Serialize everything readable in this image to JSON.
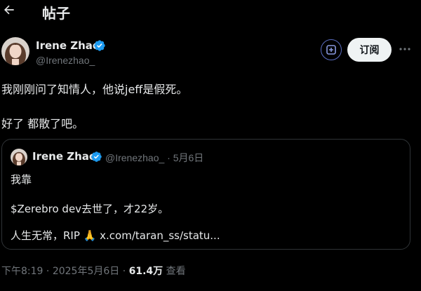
{
  "header": {
    "title": "帖子",
    "back_icon": "arrow-left-icon"
  },
  "author": {
    "name": "Irene Zhao",
    "handle": "@Irenezhao_",
    "verified": true
  },
  "actions": {
    "subscribe_label": "订阅",
    "grok_icon": "grok-icon",
    "more_icon": "more-horizontal-icon"
  },
  "post": {
    "line1": "我刚刚问了知情人，他说jeff是假死。",
    "line2": "好了 都散了吧。"
  },
  "quote": {
    "name": "Irene Zhao",
    "handle": "@Irenezhao_",
    "separator": "·",
    "date": "5月6日",
    "line1": "我靠",
    "line2": "$Zerebro dev去世了，才22岁。",
    "line3_prefix": "人生无常，RIP",
    "line3_emoji": "🙏",
    "line3_link": "x.com/taran_ss/statu..."
  },
  "footer": {
    "time": "下午8:19",
    "sep1": "·",
    "date": "2025年5月6日",
    "sep2": "·",
    "views_count": "61.4万",
    "views_label": "查看"
  },
  "colors": {
    "background": "#000000",
    "text": "#e7e9ea",
    "secondary": "#71767b",
    "verified": "#1d9bf0",
    "border": "#2f3336",
    "button_bg": "#eff3f4"
  }
}
